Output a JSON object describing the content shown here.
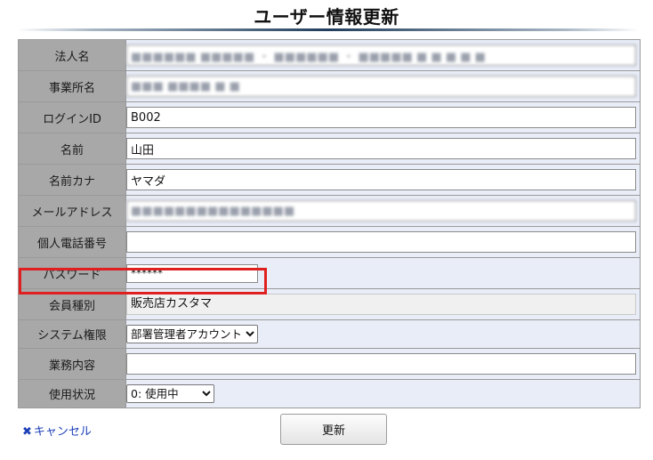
{
  "page": {
    "title": "ユーザー情報更新"
  },
  "form": {
    "corp_name": {
      "label": "法人名",
      "value": "■■■■■■ ■■■■■ ・ ■■■■■■ ・ ■■■■■ ■ ■ ■ ■ ■"
    },
    "office_name": {
      "label": "事業所名",
      "value": "■■■ ■■■■ ■ ■"
    },
    "login_id": {
      "label": "ログインID",
      "value": "B002"
    },
    "name": {
      "label": "名前",
      "value": "山田"
    },
    "name_kana": {
      "label": "名前カナ",
      "value": "ヤマダ"
    },
    "email": {
      "label": "メールアドレス",
      "value": "■■■■■■■■■■■■■■■"
    },
    "personal_phone": {
      "label": "個人電話番号",
      "value": ""
    },
    "password": {
      "label": "パスワード",
      "value": "******"
    },
    "member_type": {
      "label": "会員種別",
      "value": "販売店カスタマ"
    },
    "system_role": {
      "label": "システム権限",
      "selected": "部署管理者アカウント"
    },
    "business": {
      "label": "業務内容",
      "value": ""
    },
    "status": {
      "label": "使用状況",
      "selected": "0: 使用中"
    }
  },
  "actions": {
    "cancel_label": "キャンセル",
    "update_label": "更新"
  },
  "colors": {
    "highlight": "#e02020",
    "label_bg": "#a8a8a8",
    "value_bg": "#e8edf8",
    "link": "#1e40b8"
  }
}
